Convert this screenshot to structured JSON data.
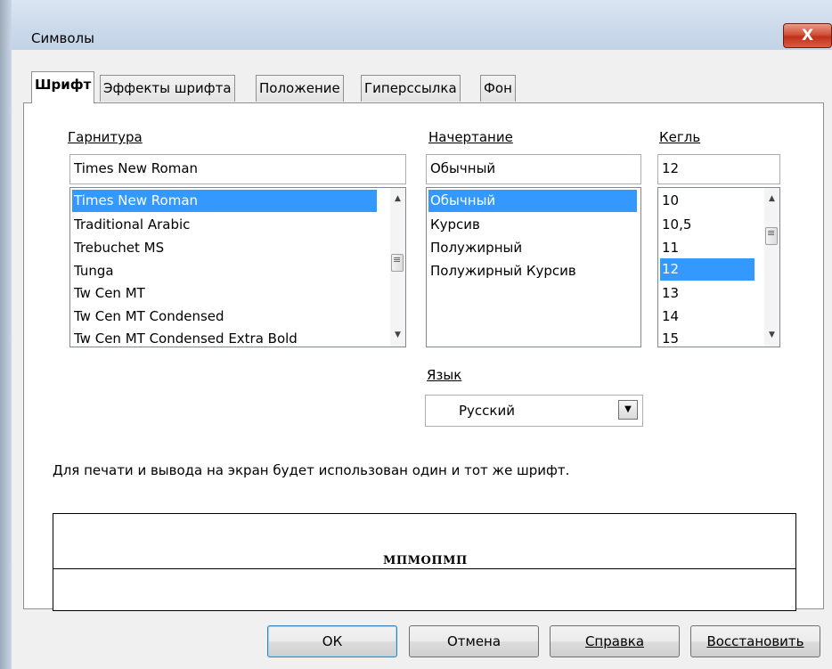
{
  "window": {
    "title": "Символы",
    "close_glyph": "X"
  },
  "tabs": [
    {
      "label": "Шрифт",
      "active": true
    },
    {
      "label": "Эффекты шрифта",
      "active": false
    },
    {
      "label": "Положение",
      "active": false
    },
    {
      "label": "Гиперссылка",
      "active": false
    },
    {
      "label": "Фон",
      "active": false
    }
  ],
  "font": {
    "label": "Гарнитура",
    "value": "Times New Roman",
    "items": [
      "Times New Roman",
      "Traditional Arabic",
      "Trebuchet MS",
      "Tunga",
      "Tw Cen MT",
      "Tw Cen MT Condensed",
      "Tw Cen MT Condensed Extra Bold"
    ],
    "selected": "Times New Roman"
  },
  "style": {
    "label": "Начертание",
    "value": "Обычный",
    "items": [
      "Обычный",
      "Курсив",
      "Полужирный",
      "Полужирный Курсив"
    ],
    "selected": "Обычный"
  },
  "size": {
    "label": "Кегль",
    "value": "12",
    "items": [
      "10",
      "10,5",
      "11",
      "12",
      "13",
      "14",
      "15"
    ],
    "selected": "12"
  },
  "language": {
    "label": "Язык",
    "value": "Русский"
  },
  "info_text": "Для печати и вывода на экран будет использован один и тот же шрифт.",
  "preview_text": "МПМОПМП",
  "buttons": {
    "ok": "ОК",
    "cancel": "Отмена",
    "help": "Справка",
    "reset": "Восстановить"
  },
  "colors": {
    "selection": "#3399ff",
    "close_button": "#c7432a"
  }
}
